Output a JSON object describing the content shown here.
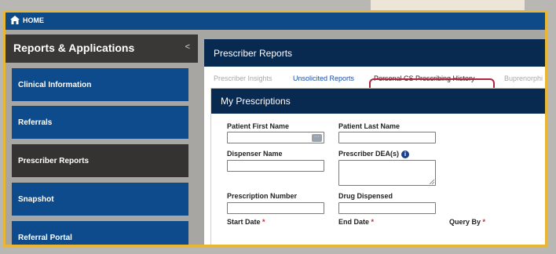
{
  "navbar": {
    "home_label": "HOME"
  },
  "sidebar": {
    "title": "Reports & Applications",
    "collapse_glyph": "<",
    "items": [
      {
        "label": "Clinical Information"
      },
      {
        "label": "Referrals"
      },
      {
        "label": "Prescriber Reports",
        "active": true
      },
      {
        "label": "Snapshot"
      },
      {
        "label": "Referral Portal"
      }
    ]
  },
  "main": {
    "card_title": "Prescriber Reports",
    "tabs": [
      {
        "label": "Prescriber Insights"
      },
      {
        "label": "Unsolicited Reports"
      },
      {
        "label": "Personal CS Prescribing History"
      },
      {
        "label": "Buprenorphi"
      }
    ],
    "panel_title": "My Prescriptions",
    "form": {
      "patient_first_name": "Patient First Name",
      "patient_last_name": "Patient Last Name",
      "dispenser_name": "Dispenser Name",
      "prescriber_dea": "Prescriber DEA(s)",
      "prescription_number": "Prescription Number",
      "drug_dispensed": "Drug Dispensed",
      "start_date": "Start Date",
      "end_date": "End Date",
      "query_by": "Query By",
      "required_mark": "*",
      "lookup_glyph": "···",
      "info_glyph": "i"
    }
  },
  "colors": {
    "nav_blue": "#0e4a88",
    "dark_header": "#082950",
    "highlight_border": "#b3223f",
    "frame_gold": "#e8b535"
  }
}
